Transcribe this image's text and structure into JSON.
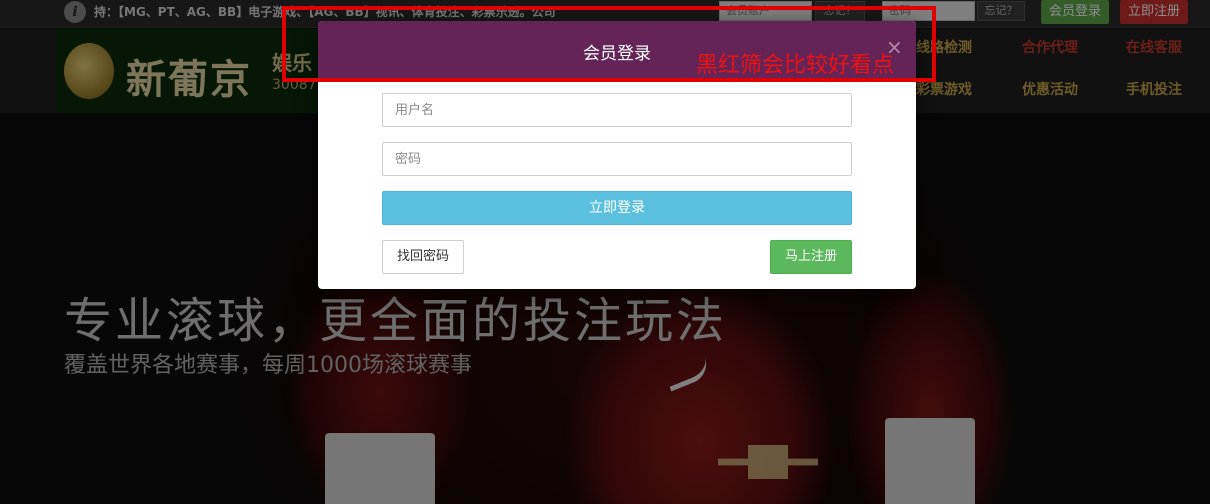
{
  "topbar": {
    "notice": "持：【MG、PT、AG、BB】电子游戏、【AG、BB】视讯、体育投注、彩票乐透。公司",
    "username_placeholder": "会员账户",
    "forgot_1": "忘记？",
    "password_placeholder": "密码",
    "forgot_2": "忘记？",
    "login_label": "会员登录",
    "register_label": "立即注册"
  },
  "header": {
    "logo_text": "新葡京",
    "logo_sub": "娱乐",
    "logo_num": "30087",
    "nav_items": [
      {
        "label": "线路检测"
      },
      {
        "label": "合作代理"
      },
      {
        "label": "在线客服"
      },
      {
        "label": "彩票游戏"
      },
      {
        "label": "优惠活动"
      },
      {
        "label": "手机投注"
      }
    ]
  },
  "hero": {
    "title": "专业滚球，更全面的投注玩法",
    "subtitle": "覆盖世界各地赛事，每周1000场滚球赛事"
  },
  "modal": {
    "title": "会员登录",
    "close": "×",
    "username_placeholder": "用户名",
    "password_placeholder": "密码",
    "login_label": "立即登录",
    "find_password_label": "找回密码",
    "register_label": "马上注册"
  },
  "annotation": {
    "text": "黑红筛会比较好看点"
  },
  "colors": {
    "modal_header": "#642457",
    "login_button": "#5bc0de",
    "register_button": "#5cb85c",
    "annotation": "#e00000"
  }
}
